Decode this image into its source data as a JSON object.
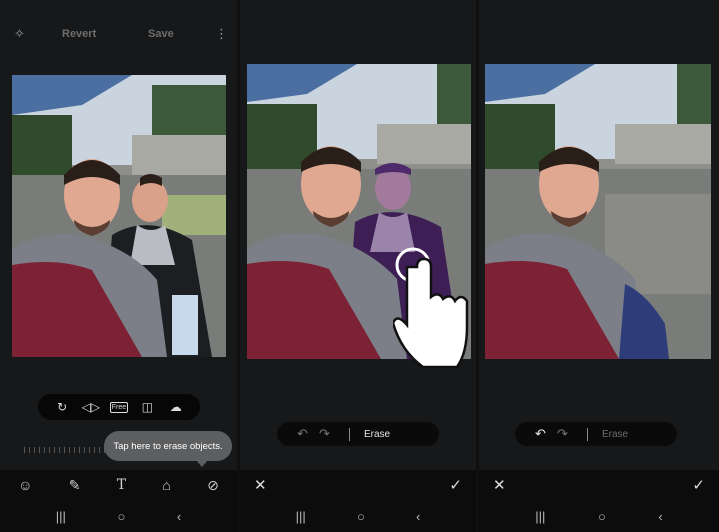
{
  "panel1": {
    "topbar": {
      "revert_label": "Revert",
      "save_label": "Save",
      "magic_icon": "sparkle-icon",
      "more_icon": "more-icon"
    },
    "tools": [
      "rotate-icon",
      "flip-icon",
      "free-ratio-icon",
      "mirror-icon",
      "cloud-icon"
    ],
    "tool_free_label": "Free",
    "tooltip": "Tap here to erase objects.",
    "bottom_tools": [
      "sticker-icon",
      "draw-icon",
      "text-icon",
      "adjust-icon",
      "object-eraser-icon"
    ]
  },
  "panel2": {
    "erase_label": "Erase"
  },
  "panel3": {
    "erase_label": "Erase"
  },
  "nav": {
    "recents": "|||",
    "home": "○",
    "back": "‹"
  },
  "colors": {
    "bg": "#17181a",
    "pill": "#0a0a0b",
    "tooltip": "#5d5e60"
  }
}
